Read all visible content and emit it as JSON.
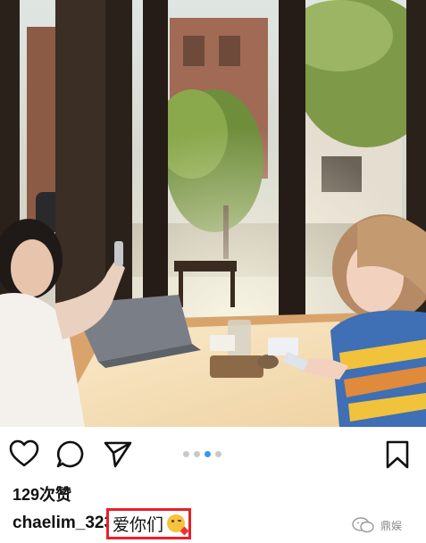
{
  "post": {
    "likes_text": "129次赞",
    "username": "chaelim_323",
    "caption": "爱你们",
    "emoji_icon": "kissing-face-heart-emoji"
  },
  "carousel": {
    "total": 4,
    "active_index": 2,
    "active_color": "#3897f0",
    "inactive_color": "#c9c9c9"
  },
  "actions": {
    "like_icon": "heart-icon",
    "comment_icon": "comment-icon",
    "share_icon": "send-icon",
    "save_icon": "bookmark-icon"
  },
  "watermark": {
    "text": "鼎娱",
    "icon": "wechat-icon"
  },
  "highlight_color": "#e8202a"
}
